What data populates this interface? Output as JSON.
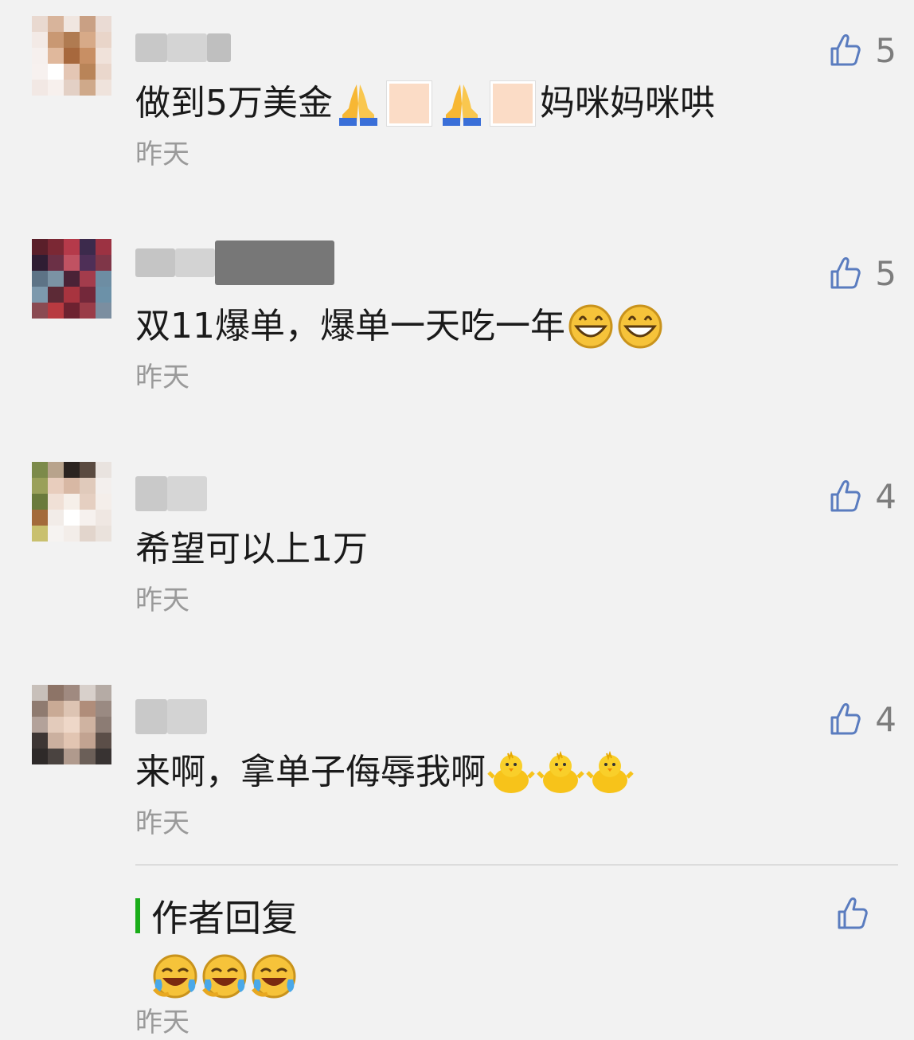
{
  "comments": [
    {
      "nickname_blur_colors": [
        "#c8c8c8",
        "#d4d4d4",
        "#bfbfbf"
      ],
      "avatar_colors": [
        "#e9d9d0",
        "#d8b49b",
        "#f0e6e0",
        "#c9a084",
        "#eadbd4",
        "#f3eae6",
        "#c99873",
        "#b07b51",
        "#d7aa88",
        "#e9d5c9",
        "#f6f0ee",
        "#e0b89c",
        "#a7683d",
        "#c88f64",
        "#f0e2da",
        "#f7f1ef",
        "#ffffff",
        "#e4c6b4",
        "#b98458",
        "#ead7cc",
        "#f2e8e4",
        "#f7f0ed",
        "#e3d0c5",
        "#cfa98a",
        "#efe3dc"
      ],
      "text_before": "做到5万美金",
      "text_after": "妈咪妈咪哄",
      "emojis": [
        "folded-hands",
        "missing-skin-tone",
        "folded-hands",
        "missing-skin-tone"
      ],
      "time": "昨天",
      "likes": "5"
    },
    {
      "nickname_blur_colors": [
        "#c5c5c5",
        "#d3d3d3",
        "#777777"
      ],
      "avatar_colors": [
        "#5a1f2a",
        "#7b2834",
        "#b53a4a",
        "#3c2a4c",
        "#9c3242",
        "#2f1d33",
        "#6b3046",
        "#c05262",
        "#4e2f57",
        "#7f3648",
        "#5d7386",
        "#7b93a4",
        "#4a2236",
        "#a33c4c",
        "#6d8da3",
        "#7d99ad",
        "#5c2a36",
        "#a8343f",
        "#73283a",
        "#6c91a8",
        "#8a4a52",
        "#b83a40",
        "#6d2230",
        "#9a3c48",
        "#7b8ea0"
      ],
      "text_before": "双11爆单，爆单一天吃一年",
      "text_after": "",
      "emojis": [
        "grinning-face",
        "grinning-face"
      ],
      "time": "昨天",
      "likes": "5"
    },
    {
      "nickname_blur_colors": [
        "#c9c9c9",
        "#d6d6d6"
      ],
      "avatar_colors": [
        "#7c8a4a",
        "#b8a38c",
        "#2b2420",
        "#5a4a40",
        "#e9e3df",
        "#9aa05a",
        "#e8cdbd",
        "#d8b8a4",
        "#e0cabb",
        "#f3efed",
        "#6a7a3c",
        "#f0e0d6",
        "#f6efe9",
        "#e5cfc1",
        "#f4eeea",
        "#a36a3a",
        "#f2ece8",
        "#ffffff",
        "#f6f1ee",
        "#efe7e2",
        "#c9c06e",
        "#f6f3f1",
        "#f3ede9",
        "#e2d5cc",
        "#eae2dc"
      ],
      "text_before": "希望可以上1万",
      "text_after": "",
      "emojis": [],
      "time": "昨天",
      "likes": "4"
    },
    {
      "nickname_blur_colors": [
        "#c9c9c9",
        "#d3d3d3"
      ],
      "avatar_colors": [
        "#c8c0ba",
        "#8d7467",
        "#a08a80",
        "#d8d0cb",
        "#b5aba5",
        "#8f7b70",
        "#c9aa95",
        "#ddc4b3",
        "#b08d7a",
        "#9a8a82",
        "#b3a29a",
        "#e3cbbb",
        "#eed7c8",
        "#cfb3a1",
        "#8c7c74",
        "#3d3634",
        "#cbb09f",
        "#e2c5b2",
        "#c2a391",
        "#5b4e48",
        "#2e2a29",
        "#4a4340",
        "#b09a8d",
        "#6b5f58",
        "#383332"
      ],
      "text_before": "来啊，拿单子侮辱我啊",
      "text_after": "",
      "emojis": [
        "hatching-chick",
        "hatching-chick",
        "hatching-chick"
      ],
      "time": "昨天",
      "likes": "4"
    }
  ],
  "author_reply": {
    "label": "作者回复",
    "emojis": [
      "face-with-tears-of-joy",
      "face-with-tears-of-joy",
      "face-with-tears-of-joy"
    ],
    "time": "昨天"
  },
  "colors": {
    "background": "#f2f2f2",
    "reply_accent": "#1aad19",
    "like_icon": "#7d7d7d",
    "time_text": "#9a9a9a"
  }
}
